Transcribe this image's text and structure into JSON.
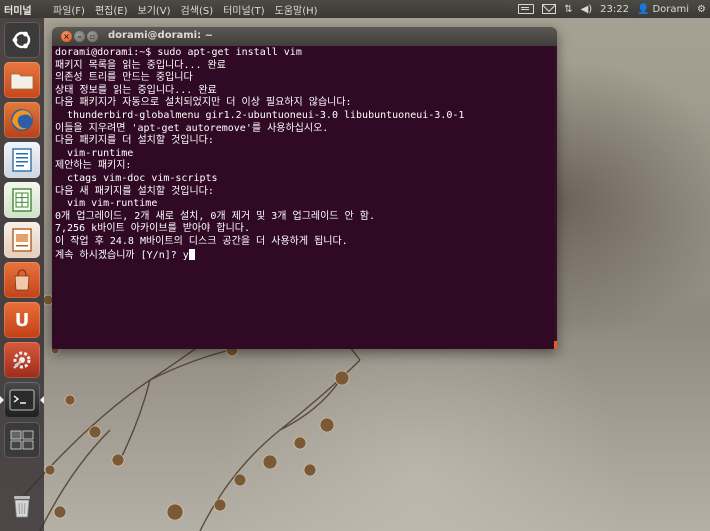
{
  "top_panel": {
    "app_name": "터미널",
    "menus": [
      "파일(F)",
      "편집(E)",
      "보기(V)",
      "검색(S)",
      "터미널(T)",
      "도움말(H)"
    ],
    "clock": "23:22",
    "user": "Dorami",
    "indicator_icons": [
      "keyboard-icon",
      "mail-icon",
      "network-icon",
      "volume-icon",
      "gear-icon"
    ]
  },
  "launcher": {
    "items": [
      {
        "name": "dash-home",
        "icon": "ubuntu-logo-icon",
        "color": "#3b3b3b"
      },
      {
        "name": "files",
        "icon": "folder-icon",
        "color": "#d9571f"
      },
      {
        "name": "firefox",
        "icon": "firefox-icon",
        "color": "#c7461d"
      },
      {
        "name": "writer",
        "icon": "writer-icon",
        "color": "#2f6ea8"
      },
      {
        "name": "calc",
        "icon": "calc-icon",
        "color": "#3c8a2c"
      },
      {
        "name": "impress",
        "icon": "impress-icon",
        "color": "#b85a1b"
      },
      {
        "name": "software-center",
        "icon": "shopping-bag-icon",
        "color": "#d2541f"
      },
      {
        "name": "ubuntu-one",
        "icon": "ubuntu-one-icon",
        "color": "#d24b1a"
      },
      {
        "name": "system-settings",
        "icon": "settings-icon",
        "color": "#b53b23"
      },
      {
        "name": "terminal",
        "icon": "terminal-icon",
        "color": "#2b2b2b"
      },
      {
        "name": "workspace-switcher",
        "icon": "workspace-icon",
        "color": "#3a3a3a"
      },
      {
        "name": "trash",
        "icon": "trash-icon",
        "color": "#3a3a3a"
      }
    ],
    "glyphs": {
      "u1": "U",
      "term": ">_"
    }
  },
  "terminal": {
    "title": "dorami@dorami: ~",
    "lines": [
      "dorami@dorami:~$ sudo apt-get install vim",
      "패키지 목록을 읽는 중입니다... 완료",
      "의존성 트리를 만드는 중입니다",
      "상태 정보를 읽는 중입니다... 완료",
      "다음 패키지가 자동으로 설치되었지만 더 이상 필요하지 않습니다:",
      "  thunderbird-globalmenu gir1.2-ubuntuoneui-3.0 libubuntuoneui-3.0-1",
      "이들을 지우려면 'apt-get autoremove'를 사용하십시오.",
      "다음 패키지를 더 설치할 것입니다:",
      "  vim-runtime",
      "제안하는 패키지:",
      "  ctags vim-doc vim-scripts",
      "다음 새 패키지를 설치할 것입니다:",
      "  vim vim-runtime",
      "0개 업그레이드, 2개 새로 설치, 0개 제거 및 3개 업그레이드 안 함.",
      "7,256 k바이트 아카이브를 받아야 합니다.",
      "이 작업 후 24.8 M바이트의 디스크 공간을 더 사용하게 됩니다.",
      "계속 하시겠습니까 [Y/n]? y"
    ],
    "colors": {
      "background": "#300a24",
      "text": "#ffffff",
      "accent": "#e85a1c"
    }
  }
}
